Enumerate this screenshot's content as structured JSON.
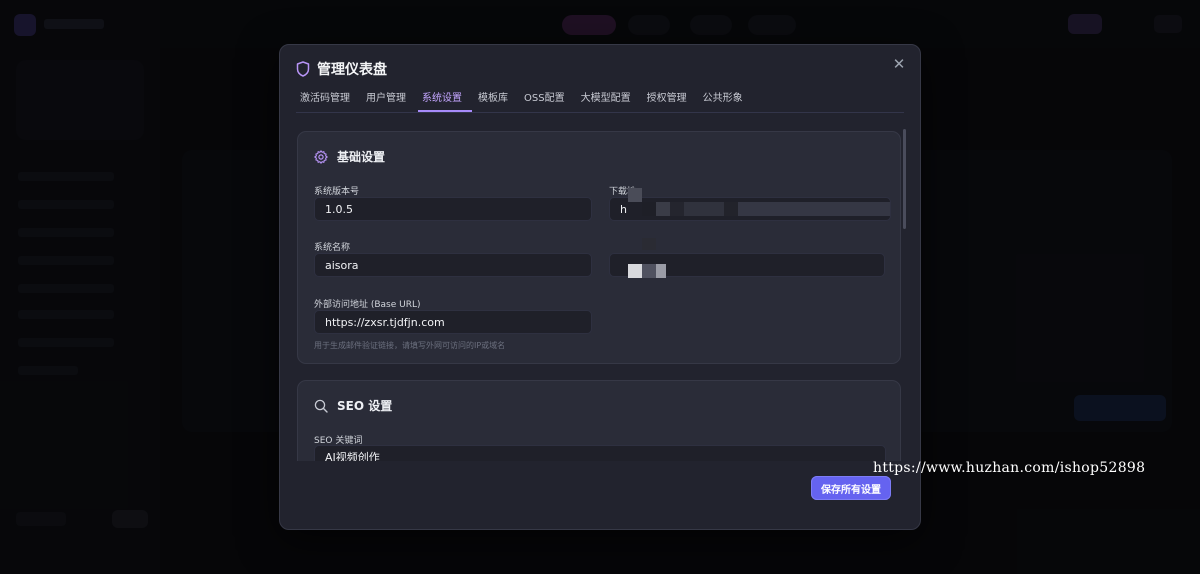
{
  "modal": {
    "title": "管理仪表盘",
    "close_icon": "close-icon",
    "tabs": [
      {
        "label": "激活码管理",
        "active": false
      },
      {
        "label": "用户管理",
        "active": false
      },
      {
        "label": "系统设置",
        "active": true
      },
      {
        "label": "模板库",
        "active": false
      },
      {
        "label": "OSS配置",
        "active": false
      },
      {
        "label": "大模型配置",
        "active": false
      },
      {
        "label": "授权管理",
        "active": false
      },
      {
        "label": "公共形象",
        "active": false
      }
    ]
  },
  "basic_settings": {
    "title": "基础设置",
    "icon": "gear-icon",
    "version_label": "系统版本号",
    "version_value": "1.0.5",
    "download_label": "下载地",
    "download_value": "h",
    "name_label": "系统名称",
    "name_value": "aisora",
    "base_url_label": "外部访问地址 (Base URL)",
    "base_url_value": "https://zxsr.tjdfjn.com",
    "base_url_hint": "用于生成邮件验证链接，请填写外网可访问的IP或域名"
  },
  "seo_settings": {
    "title": "SEO 设置",
    "icon": "search-icon",
    "keywords_label": "SEO 关键词",
    "keywords_value": "AI视频创作"
  },
  "footer": {
    "save_label": "保存所有设置"
  },
  "watermark": "https://www.huzhan.com/ishop52898",
  "colors": {
    "accent": "#a78bfa",
    "button": "#6563f0",
    "modal_bg": "#22232e",
    "card_bg": "#2a2c38"
  }
}
